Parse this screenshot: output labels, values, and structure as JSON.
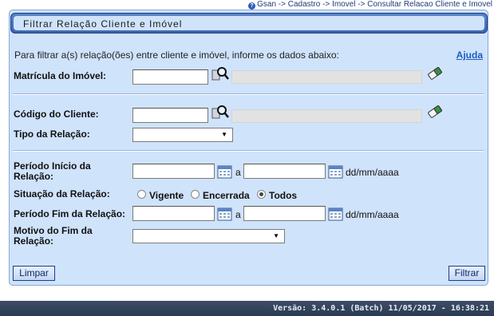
{
  "breadcrumb": {
    "home": "Gsan",
    "sep1": " -> ",
    "level2": "Cadastro",
    "sep2": " -> ",
    "level3": "Imovel",
    "sep3": " -> ",
    "current": "Consultar Relacao Cliente e Imovel"
  },
  "panel": {
    "title": "Filtrar Relação Cliente e Imóvel"
  },
  "intro": {
    "text": "Para filtrar a(s) relação(ões) entre cliente e imóvel, informe os dados abaixo:",
    "help_label": "Ajuda"
  },
  "fields": {
    "matricula": {
      "label": "Matrícula do Imóvel:",
      "value": "",
      "description": ""
    },
    "codigo_cliente": {
      "label": "Código do Cliente:",
      "value": "",
      "description": ""
    },
    "tipo_relacao": {
      "label": "Tipo da Relação:",
      "selected": ""
    },
    "periodo_inicio": {
      "label_line1": "Período Início da",
      "label_line2": "Relação:",
      "from": "",
      "to": "",
      "connector": "a",
      "format_hint": "dd/mm/aaaa"
    },
    "situacao": {
      "label": "Situação da Relação:",
      "options": [
        "Vigente",
        "Encerrada",
        "Todos"
      ],
      "selected": "Todos"
    },
    "periodo_fim": {
      "label": "Período Fim da Relação:",
      "from": "",
      "to": "",
      "connector": "a",
      "format_hint": "dd/mm/aaaa"
    },
    "motivo_fim": {
      "label_line1": "Motivo do Fim da",
      "label_line2": "Relação:",
      "selected": ""
    }
  },
  "buttons": {
    "limpar": "Limpar",
    "filtrar": "Filtrar"
  },
  "footer": {
    "version": "Versão: 3.4.0.1 (Batch) 11/05/2017 - 16:38:21"
  }
}
